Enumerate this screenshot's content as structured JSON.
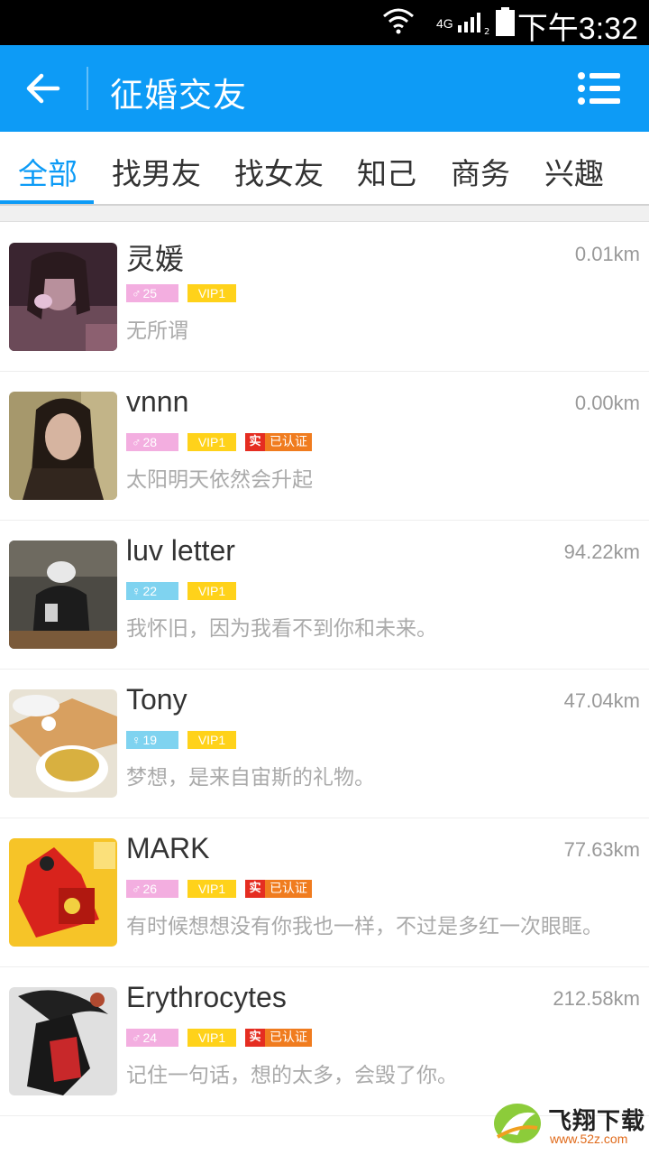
{
  "status_bar": {
    "time": "下午3:32",
    "network": "4G",
    "sim": "2"
  },
  "app_bar": {
    "title": "征婚交友"
  },
  "tabs": [
    {
      "label": "全部",
      "active": true
    },
    {
      "label": "找男友",
      "active": false
    },
    {
      "label": "找女友",
      "active": false
    },
    {
      "label": "知己",
      "active": false
    },
    {
      "label": "商务",
      "active": false
    },
    {
      "label": "兴趣",
      "active": false
    }
  ],
  "users": [
    {
      "name": "灵媛",
      "distance": "0.01km",
      "gender": "female",
      "gender_symbol": "♂",
      "age": "25",
      "vip": "VIP1",
      "verified": false,
      "signature": "无所谓"
    },
    {
      "name": "vnnn",
      "distance": "0.00km",
      "gender": "female",
      "gender_symbol": "♂",
      "age": "28",
      "vip": "VIP1",
      "verified": true,
      "verify_mark": "实",
      "verify_label": "已认证",
      "signature": "太阳明天依然会升起"
    },
    {
      "name": "luv letter",
      "distance": "94.22km",
      "gender": "male",
      "gender_symbol": "♀",
      "age": "22",
      "vip": "VIP1",
      "verified": false,
      "signature": "我怀旧，因为我看不到你和未来。"
    },
    {
      "name": "Tony",
      "distance": "47.04km",
      "gender": "male",
      "gender_symbol": "♀",
      "age": "19",
      "vip": "VIP1",
      "verified": false,
      "signature": "梦想，是来自宙斯的礼物。"
    },
    {
      "name": "MARK",
      "distance": "77.63km",
      "gender": "female",
      "gender_symbol": "♂",
      "age": "26",
      "vip": "VIP1",
      "verified": true,
      "verify_mark": "实",
      "verify_label": "已认证",
      "signature": "有时候想想没有你我也一样，不过是多红一次眼眶。"
    },
    {
      "name": "Erythrocytes",
      "distance": "212.58km",
      "gender": "female",
      "gender_symbol": "♂",
      "age": "24",
      "vip": "VIP1",
      "verified": true,
      "verify_mark": "实",
      "verify_label": "已认证",
      "signature": "记住一句话，想的太多，会毁了你。"
    }
  ],
  "watermark": {
    "title": "飞翔下载",
    "url": "www.52z.com"
  },
  "colors": {
    "accent": "#0d9bf6",
    "female_badge": "#f3aee0",
    "male_badge": "#7fd3f0",
    "vip_badge": "#ffd21a",
    "verify_red": "#e52d21",
    "verify_orange": "#f07c1f"
  }
}
